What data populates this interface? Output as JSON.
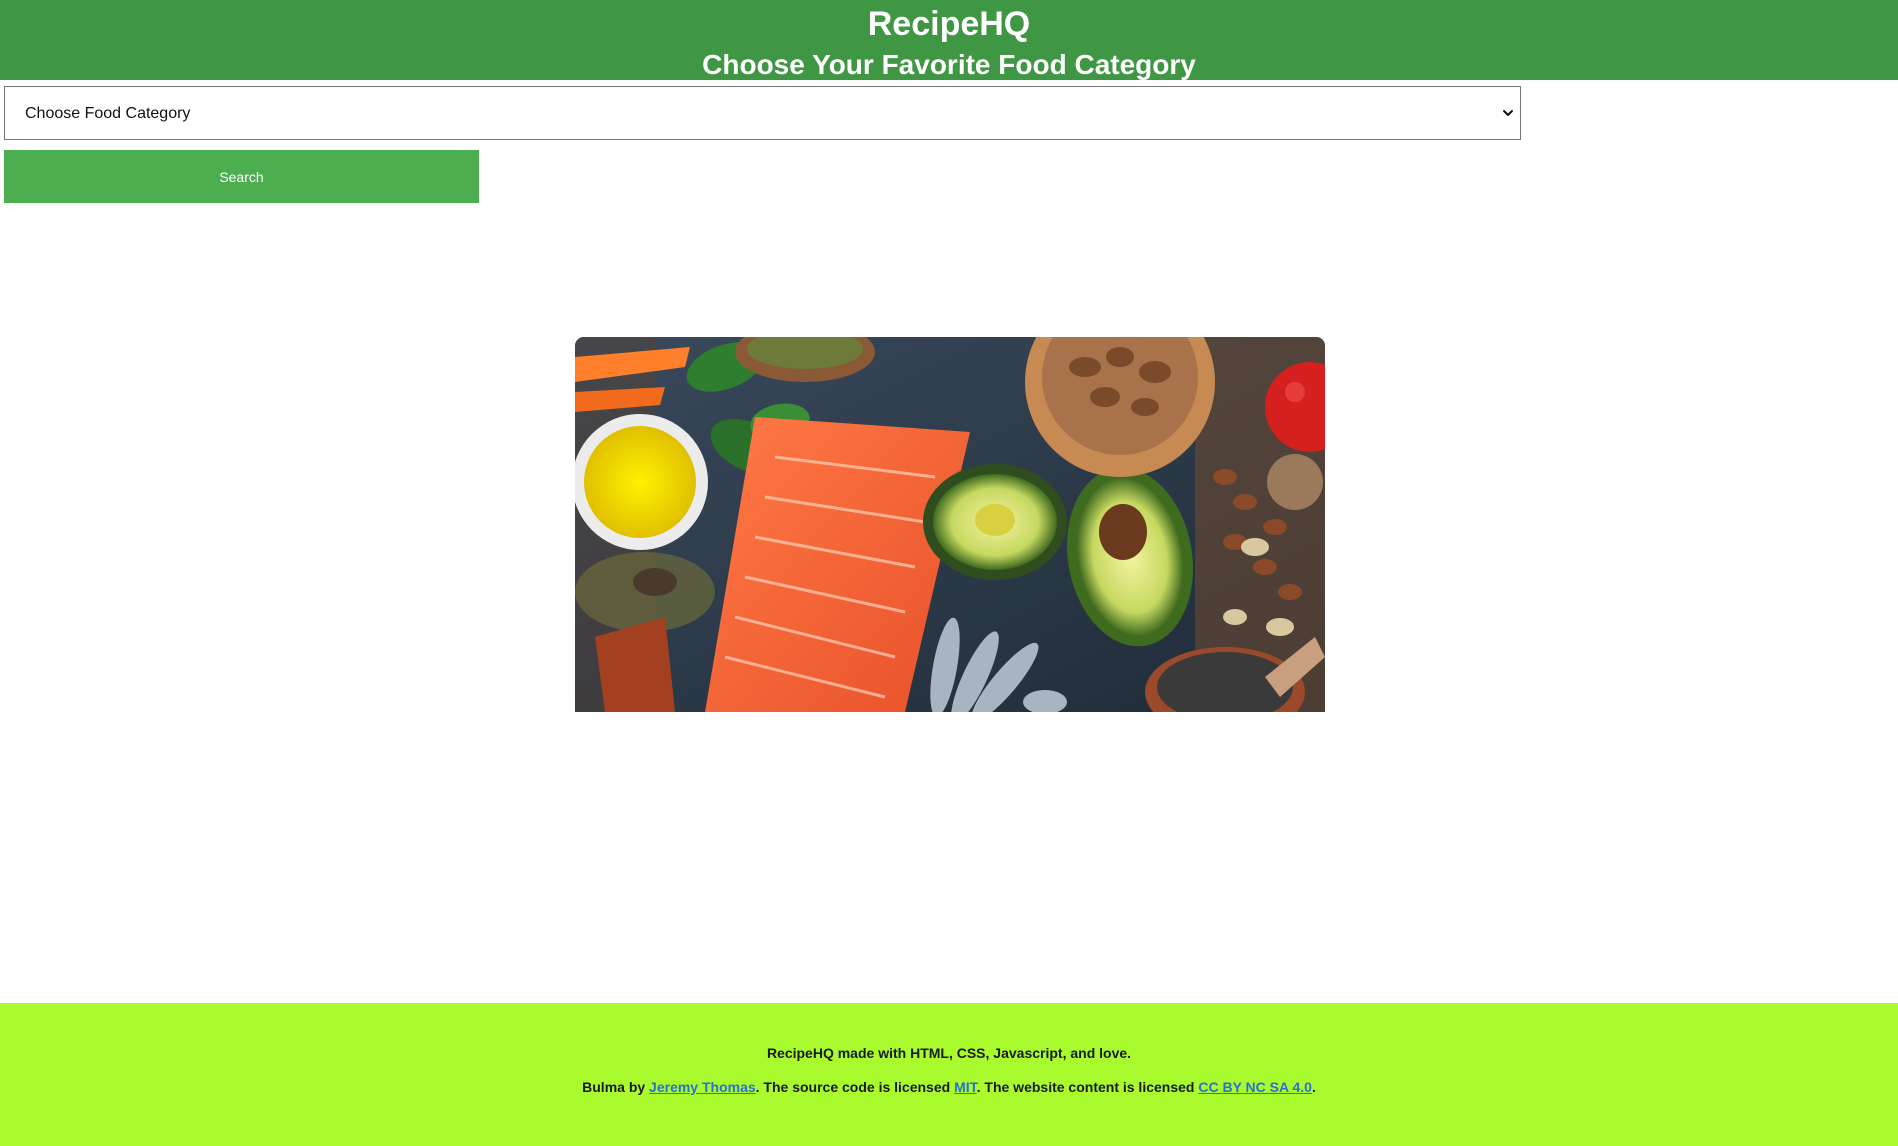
{
  "header": {
    "title": "RecipeHQ",
    "subtitle": "Choose Your Favorite Food Category",
    "background": "#3f9643"
  },
  "category_select": {
    "selected": "Choose Food Category"
  },
  "search_button": {
    "label": "Search",
    "background": "#4cae4f"
  },
  "hero_image": {
    "subject": "healthy-foods-salmon-avocado-nuts"
  },
  "footer": {
    "background": "#a9fb2e",
    "line1": "RecipeHQ made with HTML, CSS, Javascript, and love.",
    "line2_prefix": "Bulma by ",
    "author_link": "Jeremy Thomas",
    "line2_mid1": ". The source code is licensed ",
    "license_code_link": "MIT",
    "line2_mid2": ". The website content is licensed ",
    "license_content_link": "CC BY NC SA 4.0",
    "line2_suffix": ".",
    "link_color": "#2a6fd6"
  }
}
